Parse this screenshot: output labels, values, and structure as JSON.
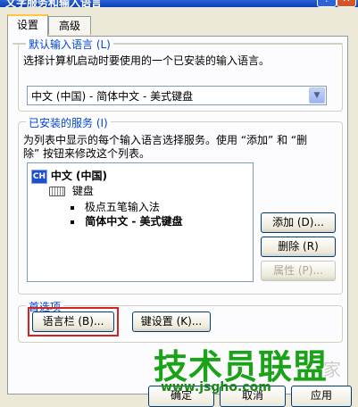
{
  "window": {
    "title": "文字服务和输入语言"
  },
  "tabs": [
    {
      "label": "设置"
    },
    {
      "label": "高级"
    }
  ],
  "default_language": {
    "legend": "默认输入语言 (L)",
    "description": "选择计算机启动时要使用的一个已安装的输入语言。",
    "selected": "中文 (中国) - 简体中文 - 美式键盘"
  },
  "installed_services": {
    "legend": "已安装的服务 (I)",
    "description_line1": "为列表中显示的每个输入语言选择服务。使用 “添加” 和 “删",
    "description_line2": "除” 按钮来修改这个列表。",
    "tree": {
      "language_badge": "CH",
      "language": "中文 (中国)",
      "keyboard_label": "键盘",
      "items": [
        {
          "label": "极点五笔输入法",
          "bold": false
        },
        {
          "label": "简体中文 - 美式键盘",
          "bold": true
        }
      ]
    },
    "buttons": {
      "add": "添加 (D)...",
      "remove": "删除 (R)",
      "properties": "属性 (P)..."
    }
  },
  "preferences": {
    "legend": "首选项",
    "language_bar_button": "语言栏 (B)...",
    "key_settings_button": "键设置 (K)..."
  },
  "footer": {
    "ok": "确定",
    "cancel": "取消",
    "apply": "应用"
  },
  "watermark": {
    "main": "技术员联盟",
    "url": "www.jsgho.com",
    "extra": "家"
  },
  "colors": {
    "group_label": "#0046d5",
    "highlight": "#d62121",
    "watermark": "#1aa317"
  }
}
